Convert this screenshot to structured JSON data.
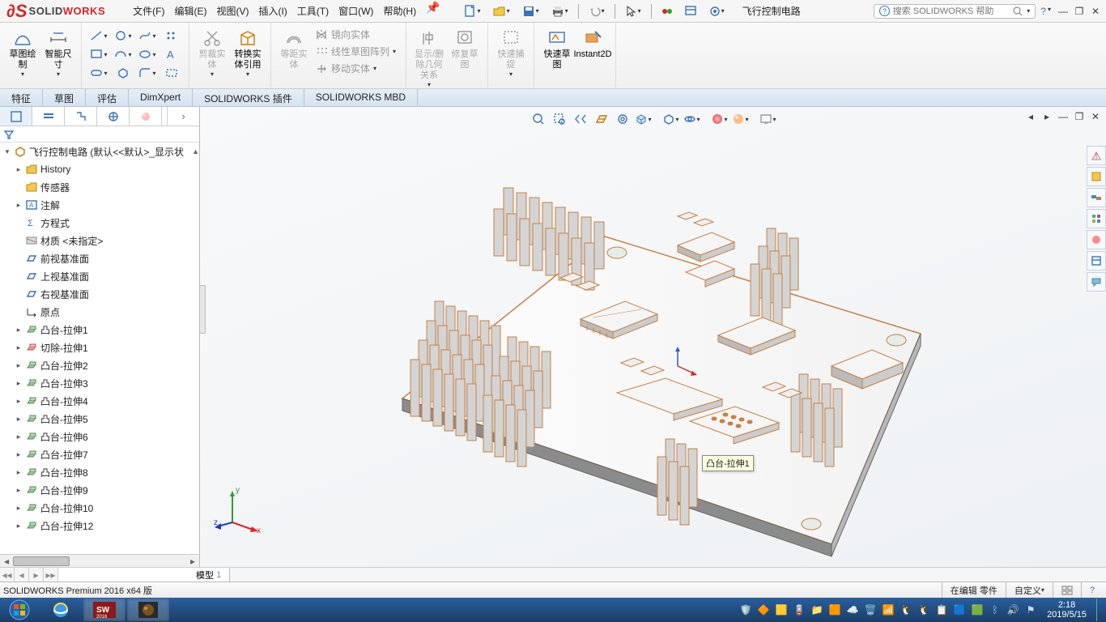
{
  "app": {
    "brand_solid": "SOLID",
    "brand_works": "WORKS"
  },
  "menu": {
    "items": [
      "文件(F)",
      "编辑(E)",
      "视图(V)",
      "插入(I)",
      "工具(T)",
      "窗口(W)",
      "帮助(H)"
    ]
  },
  "doc_name": "飞行控制电路",
  "search_placeholder": "搜索 SOLIDWORKS 帮助",
  "ribbon": {
    "big": {
      "sketch_draw": "草图绘制",
      "smart_dim": "智能尺寸",
      "trim": "剪裁实体",
      "convert": "转换实体引用",
      "offset": "等距实体",
      "mirror": "镜向实体",
      "linear": "线性草图阵列",
      "move": "移动实体",
      "show_rel": "显示/删除几何关系",
      "repair": "修复草图",
      "snap": "快速捕捉",
      "quick": "快速草图",
      "instant2d": "Instant2D"
    }
  },
  "tabs": [
    "特征",
    "草图",
    "评估",
    "DimXpert",
    "SOLIDWORKS 插件",
    "SOLIDWORKS MBD"
  ],
  "tree": {
    "root": "飞行控制电路  (默认<<默认>_显示状",
    "items": [
      "History",
      "传感器",
      "注解",
      "方程式",
      "材质 <未指定>",
      "前视基准面",
      "上视基准面",
      "右视基准面",
      "原点",
      "凸台-拉伸1",
      "切除-拉伸1",
      "凸台-拉伸2",
      "凸台-拉伸3",
      "凸台-拉伸4",
      "凸台-拉伸5",
      "凸台-拉伸6",
      "凸台-拉伸7",
      "凸台-拉伸8",
      "凸台-拉伸9",
      "凸台-拉伸10",
      "凸台-拉伸12"
    ]
  },
  "tooltip": "凸台-拉伸1",
  "triad": {
    "x": "x",
    "y": "y",
    "z": "z"
  },
  "doc_tab": {
    "label": "模型",
    "index": "1"
  },
  "status": {
    "left": "SOLIDWORKS Premium 2016 x64 版",
    "editing": "在编辑 零件",
    "custom": "自定义"
  },
  "taskbar": {
    "time": "2:18",
    "date": "2019/5/15"
  }
}
